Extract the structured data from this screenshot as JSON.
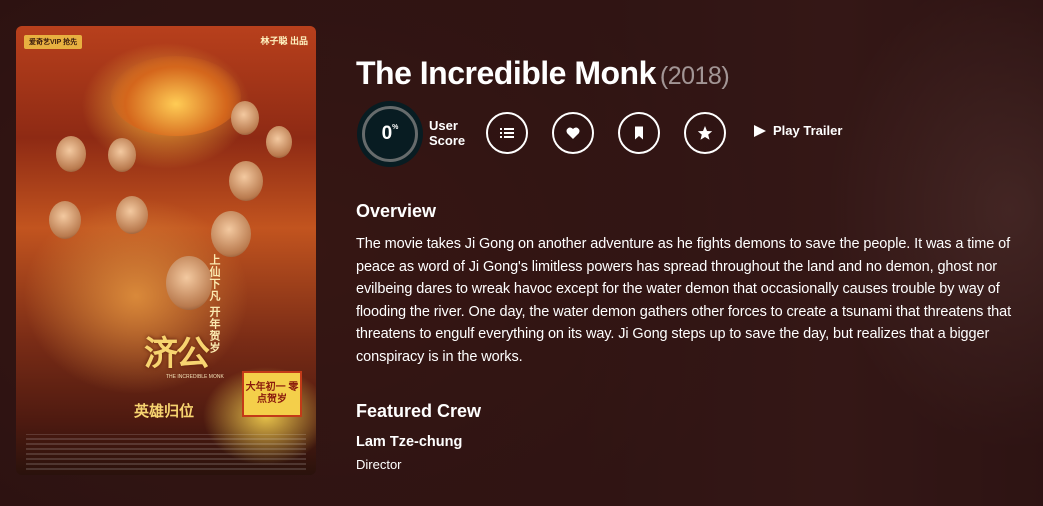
{
  "movie": {
    "title": "The Incredible Monk",
    "year": "(2018)"
  },
  "poster": {
    "vip_tag": "爱奇艺VIP 抢先",
    "brand": "林子聪 出品",
    "chinese_title": "济公",
    "chinese_subtitle": "英雄归位",
    "slogan": "上仙下凡 开年贺岁",
    "english_title": "THE INCREDIBLE MONK",
    "release_badge": "大年初一 零点贺岁"
  },
  "score": {
    "value": "0",
    "unit": "%",
    "label_line1": "User",
    "label_line2": "Score",
    "ring_color": "#666b6c"
  },
  "actions": {
    "list_icon": "list-icon",
    "favorite_icon": "heart-icon",
    "watchlist_icon": "bookmark-icon",
    "rate_icon": "star-icon",
    "play_trailer_label": "Play Trailer",
    "play_icon": "play-icon"
  },
  "overview": {
    "heading": "Overview",
    "text": "The movie takes Ji Gong on another adventure as he fights demons to save the people. It was a time of peace as word of Ji Gong's limitless powers has spread throughout the land and no demon, ghost nor evilbeing dares to wreak havoc except for the water demon that occasionally causes trouble by way of flooding the river. One day, the water demon gathers other forces to create a tsunami that threatens that threatens to engulf everything on its way. Ji Gong steps up to save the day, but realizes that a bigger conspiracy is in the works."
  },
  "crew": {
    "heading": "Featured Crew",
    "members": [
      {
        "name": "Lam Tze-chung",
        "job": "Director"
      }
    ]
  },
  "colors": {
    "background": "#3c1a1a",
    "score_bg": "#081c22",
    "text": "#ffffff"
  }
}
